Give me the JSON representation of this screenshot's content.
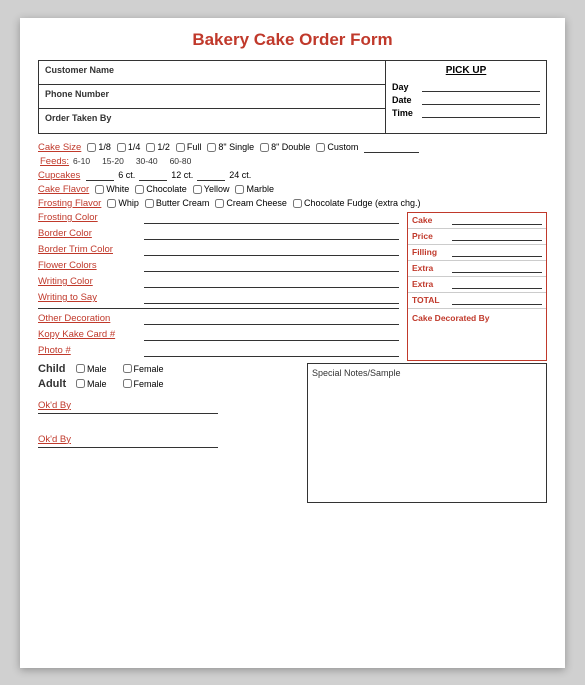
{
  "title": "Bakery Cake Order Form",
  "top": {
    "customer_name_label": "Customer Name",
    "phone_label": "Phone Number",
    "order_taken_label": "Order Taken By",
    "pickup_title": "PICK UP",
    "day_label": "Day",
    "date_label": "Date",
    "time_label": "Time"
  },
  "cake_size": {
    "label": "Cake Size",
    "options": [
      "1/8",
      "1/4",
      "1/2",
      "Full",
      "8\" Single",
      "8\" Double",
      "Custom"
    ],
    "feeds_label": "Feeds:",
    "feeds_ranges": [
      "6-10",
      "15-20",
      "30-40",
      "60-80"
    ]
  },
  "cupcakes": {
    "label": "Cupcakes",
    "qty1_label": "6 ct.",
    "qty2_label": "12 ct.",
    "qty3_label": "24 ct."
  },
  "cake_flavor": {
    "label": "Cake Flavor",
    "options": [
      "White",
      "Chocolate",
      "Yellow",
      "Marble"
    ]
  },
  "frosting_flavor": {
    "label": "Frosting Flavor",
    "options": [
      "Whip",
      "Butter Cream",
      "Cream Cheese",
      "Chocolate Fudge (extra chg.)"
    ]
  },
  "frosting_color": {
    "label": "Frosting Color"
  },
  "border_color": {
    "label": "Border Color"
  },
  "border_trim_color": {
    "label": "Border Trim Color"
  },
  "flower_colors": {
    "label": "Flower Colors"
  },
  "writing_color": {
    "label": "Writing Color"
  },
  "writing_to_say": {
    "label": "Writing to Say"
  },
  "other_decoration": {
    "label": "Other Decoration"
  },
  "kopy_kake": {
    "label": "Kopy Kake Card #"
  },
  "photo": {
    "label": "Photo #"
  },
  "child": {
    "label": "Child",
    "male_label": "Male",
    "female_label": "Female"
  },
  "adult": {
    "label": "Adult",
    "male_label": "Male",
    "female_label": "Female"
  },
  "special_notes": {
    "label": "Special Notes/Sample"
  },
  "okd_by": {
    "label": "Ok'd By"
  },
  "okd_by2": {
    "label": "Ok'd By"
  },
  "price_box": {
    "cake_label": "Cake",
    "price_label": "Price",
    "filling_label": "Filling",
    "extra1_label": "Extra",
    "extra2_label": "Extra",
    "total_label": "TOTAL",
    "decorated_by_label": "Cake Decorated By"
  }
}
